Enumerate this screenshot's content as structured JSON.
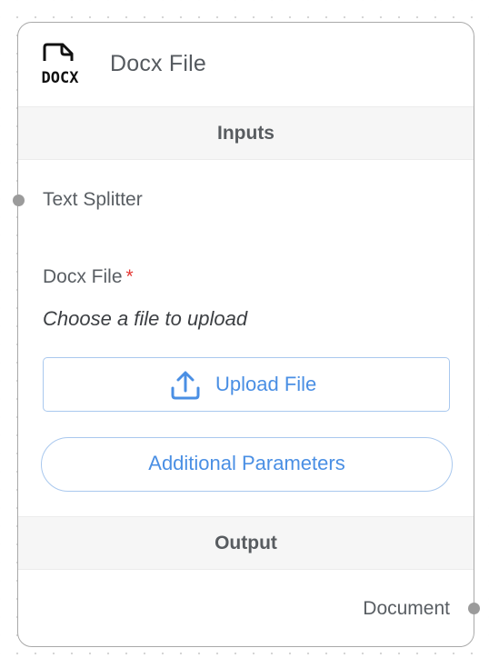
{
  "node": {
    "title": "Docx File",
    "icon": "docx-file-icon",
    "icon_text": "DOCX"
  },
  "inputs": {
    "header": "Inputs",
    "anchors": [
      {
        "label": "Text Splitter"
      }
    ],
    "file_field": {
      "label": "Docx File",
      "required_mark": "*",
      "hint": "Choose a file to upload",
      "upload_button": {
        "label": "Upload File",
        "icon": "upload-icon"
      }
    },
    "additional_params_button": "Additional Parameters"
  },
  "output": {
    "header": "Output",
    "anchors": [
      {
        "label": "Document"
      }
    ]
  },
  "colors": {
    "accent_blue": "#4a8fe4",
    "border_blue": "#a9c8ee",
    "required_red": "#e53935",
    "handle_grey": "#9b9b9b",
    "section_bg": "#f6f6f6"
  }
}
